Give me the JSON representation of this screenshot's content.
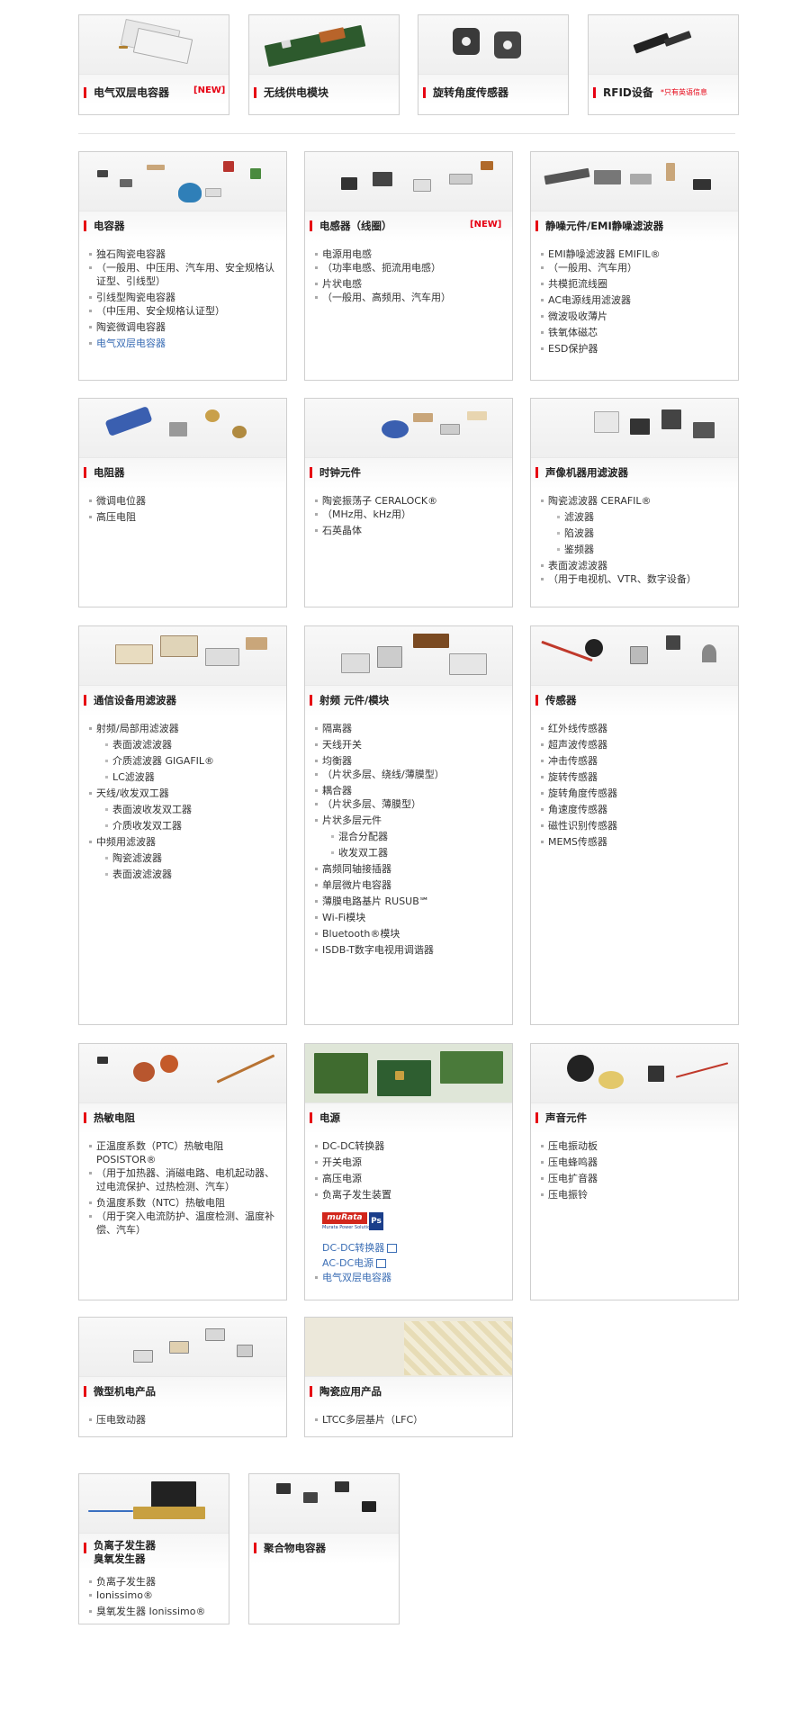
{
  "top_cards": [
    {
      "title": "电气双层电容器",
      "badge": "[NEW]"
    },
    {
      "title": "无线供电模块"
    },
    {
      "title": "旋转角度传感器"
    },
    {
      "title": "RFID设备",
      "note": "*只有英语信息"
    }
  ],
  "cards": {
    "capacitor": {
      "title": "电容器",
      "items": [
        "独石陶瓷电容器",
        "（一般用、中压用、汽车用、安全规格认证型、引线型）",
        "引线型陶瓷电容器",
        "（中压用、安全规格认证型）",
        "陶瓷微调电容器",
        "电气双层电容器"
      ]
    },
    "inductor": {
      "title": "电感器（线圈）",
      "badge": "[NEW]",
      "items": [
        "电源用电感",
        "（功率电感、扼流用电感）",
        "片状电感",
        "（一般用、高频用、汽车用）"
      ]
    },
    "emi": {
      "title": "静噪元件/EMI静噪滤波器",
      "items": [
        "EMI静噪滤波器 EMIFIL®",
        "（一般用、汽车用）",
        "共模扼流线圈",
        "AC电源线用滤波器",
        "微波吸收薄片",
        "铁氧体磁芯",
        "ESD保护器"
      ]
    },
    "resistor": {
      "title": "电阻器",
      "items": [
        "微调电位器",
        "高压电阻"
      ]
    },
    "clock": {
      "title": "时钟元件",
      "items": [
        "陶瓷振荡子 CERALOCK®",
        "（MHz用、kHz用）",
        "石英晶体"
      ]
    },
    "av": {
      "title": "声像机器用滤波器",
      "items": [
        "陶瓷滤波器 CERAFIL®",
        "滤波器",
        "陷波器",
        "鉴频器",
        "表面波滤波器",
        "（用于电视机、VTR、数字设备）"
      ]
    },
    "comm": {
      "title": "通信设备用滤波器",
      "items": [
        "射频/局部用滤波器",
        "表面波滤波器",
        "介质滤波器 GIGAFIL®",
        "LC滤波器",
        "天线/收发双工器",
        "表面波收发双工器",
        "介质收发双工器",
        "中频用滤波器",
        "陶瓷滤波器",
        "表面波滤波器"
      ]
    },
    "rf": {
      "title": "射频 元件/模块",
      "items": [
        "隔离器",
        "天线开关",
        "均衡器",
        "（片状多层、绕线/薄膜型）",
        "耦合器",
        "（片状多层、薄膜型）",
        "片状多层元件",
        "混合分配器",
        "收发双工器",
        "高频同轴接插器",
        "单层微片电容器",
        "薄膜电路基片 RUSUB℠",
        "Wi-Fi模块",
        "Bluetooth®模块",
        "ISDB-T数字电视用调谐器"
      ]
    },
    "sensor": {
      "title": "传感器",
      "items": [
        "红外线传感器",
        "超声波传感器",
        "冲击传感器",
        "旋转传感器",
        "旋转角度传感器",
        "角速度传感器",
        "磁性识别传感器",
        "MEMS传感器"
      ]
    },
    "thermistor": {
      "title": "热敏电阻",
      "items": [
        "正温度系数（PTC）热敏电阻 POSISTOR®",
        "（用于加热器、消磁电路、电机起动器、过电流保护、过热检测、汽车）",
        "负温度系数（NTC）热敏电阻",
        "（用于突入电流防护、温度检测、温度补偿、汽车）"
      ]
    },
    "power": {
      "title": "电源",
      "items": [
        "DC-DC转换器",
        "开关电源",
        "高压电源",
        "负离子发生装置"
      ],
      "brand": "muRata",
      "brand_sub": "Murata Power Solutions",
      "links": [
        "DC-DC转换器",
        "AC-DC电源"
      ],
      "last": "电气双层电容器"
    },
    "sound": {
      "title": "声音元件",
      "items": [
        "压电振动板",
        "压电蜂鸣器",
        "压电扩音器",
        "压电振铃"
      ]
    },
    "micro": {
      "title": "微型机电产品",
      "items": [
        "压电致动器"
      ]
    },
    "ceramic": {
      "title": "陶瓷应用产品",
      "items": [
        "LTCC多层基片（LFC）"
      ]
    },
    "ion": {
      "title": "负离子发生器",
      "title2": "臭氧发生器",
      "items": [
        "负离子发生器",
        "Ionissimo®",
        "臭氧发生器 Ionissimo®"
      ]
    },
    "polymer": {
      "title": "聚合物电容器"
    }
  }
}
